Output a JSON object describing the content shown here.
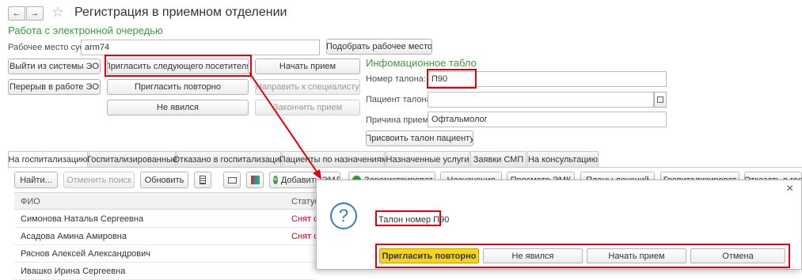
{
  "window": {
    "title": "Регистрация в приемном отделении",
    "back_glyph": "←",
    "forward_glyph": "→",
    "star_glyph": "☆"
  },
  "queue": {
    "heading": "Работа с электронной очередью",
    "workplace_label": "Рабочее место суо:",
    "workplace_value": "arm74",
    "pick_workplace": "Подобрать рабочее место",
    "exit_eo": "Выйти из системы ЭО",
    "invite_next": "Пригласить следующего посетителя",
    "start_reception": "Начать прием",
    "break_eo": "Перерыв в работе ЭО",
    "invite_again": "Пригласить повторно",
    "send_specialist": "Направить к специалисту",
    "not_appeared": "Не явился",
    "finish_reception": "Закончить прием"
  },
  "board": {
    "heading": "Инфомационное табло",
    "ticket_label": "Номер талона:",
    "ticket_value": "П90",
    "patient_label": "Пациент талона:",
    "patient_value": "",
    "reason_label": "Причина приема:",
    "reason_value": "Офтальмолог",
    "assign_button": "Присвоить талон пациенту"
  },
  "tabs": [
    "На госпитализацию",
    "Госпитализированные",
    "Отказано в госпитализации",
    "Пациенты по назначениям",
    "Назначенные услуги",
    "Заявки СМП",
    "На консультацию"
  ],
  "toolbar": {
    "find": "Найти...",
    "cancel_search": "Отменить поиск",
    "refresh": "Обновить",
    "add": "Добавить ЭМД",
    "register": "Зарегистрироват",
    "appointments": "Назначения",
    "view_emk": "Просмотр ЭМК",
    "plans": "Планы лечений",
    "hospitalize": "Госпитализироват",
    "refuse": "Отказать в гос"
  },
  "table": {
    "columns": [
      "ФИО",
      "Статус"
    ],
    "rows": [
      {
        "name": "Симонова Наталья Сергеевна",
        "status": "Снят с"
      },
      {
        "name": "Асадова Амина Амировна",
        "status": "Снят с"
      },
      {
        "name": "Ряснов Алексей Александрович",
        "status": ""
      },
      {
        "name": "Ивашко Ирина Сергеевна",
        "status": ""
      }
    ]
  },
  "dialog": {
    "close_glyph": "×",
    "icon_glyph": "?",
    "message": "Талон номер П90",
    "buttons": [
      "Пригласить повторно",
      "Не явился",
      "Начать прием",
      "Отмена"
    ]
  },
  "colors": {
    "heading_green": "#3e9a3e",
    "highlight_red": "#e3000f",
    "status_red": "#d0021b",
    "default_button_yellow": "#f7d51c",
    "dialog_icon_blue": "#2d7fc1"
  }
}
